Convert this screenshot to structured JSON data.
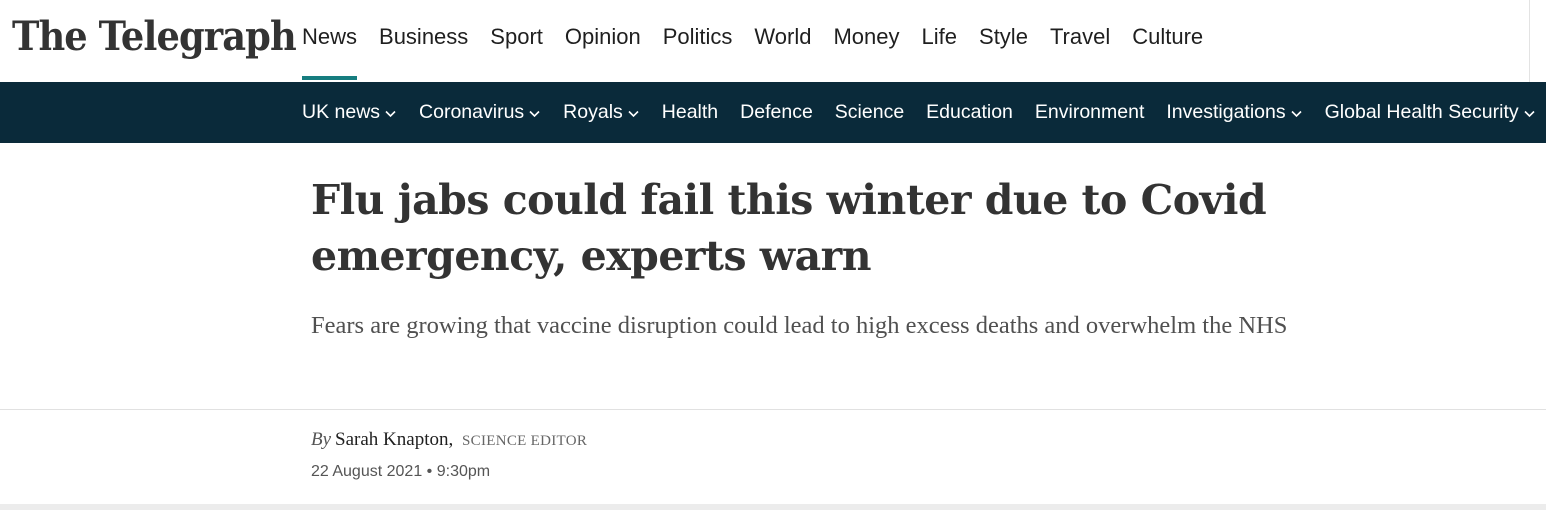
{
  "brand": {
    "logo_text": "The Telegraph"
  },
  "main_nav": {
    "items": [
      {
        "label": "News",
        "active": true
      },
      {
        "label": "Business"
      },
      {
        "label": "Sport"
      },
      {
        "label": "Opinion"
      },
      {
        "label": "Politics"
      },
      {
        "label": "World"
      },
      {
        "label": "Money"
      },
      {
        "label": "Life"
      },
      {
        "label": "Style"
      },
      {
        "label": "Travel"
      },
      {
        "label": "Culture"
      }
    ],
    "active_underline_color": "#167d7f"
  },
  "sub_nav": {
    "background_color": "#0a2a3a",
    "items": [
      {
        "label": "UK news",
        "has_dropdown": true
      },
      {
        "label": "Coronavirus",
        "has_dropdown": true
      },
      {
        "label": "Royals",
        "has_dropdown": true
      },
      {
        "label": "Health",
        "has_dropdown": false
      },
      {
        "label": "Defence",
        "has_dropdown": false
      },
      {
        "label": "Science",
        "has_dropdown": false
      },
      {
        "label": "Education",
        "has_dropdown": false
      },
      {
        "label": "Environment",
        "has_dropdown": false
      },
      {
        "label": "Investigations",
        "has_dropdown": true
      },
      {
        "label": "Global Health Security",
        "has_dropdown": true
      }
    ]
  },
  "article": {
    "headline": "Flu jabs could fail this winter due to Covid emergency, experts warn",
    "standfirst": "Fears are growing that vaccine disruption could lead to high excess deaths and overwhelm the NHS",
    "byline": {
      "prefix": "By",
      "author": "Sarah Knapton",
      "separator": ",",
      "role": "Science Editor"
    },
    "date": "22 August 2021",
    "date_separator": "•",
    "time": "9:30pm"
  }
}
